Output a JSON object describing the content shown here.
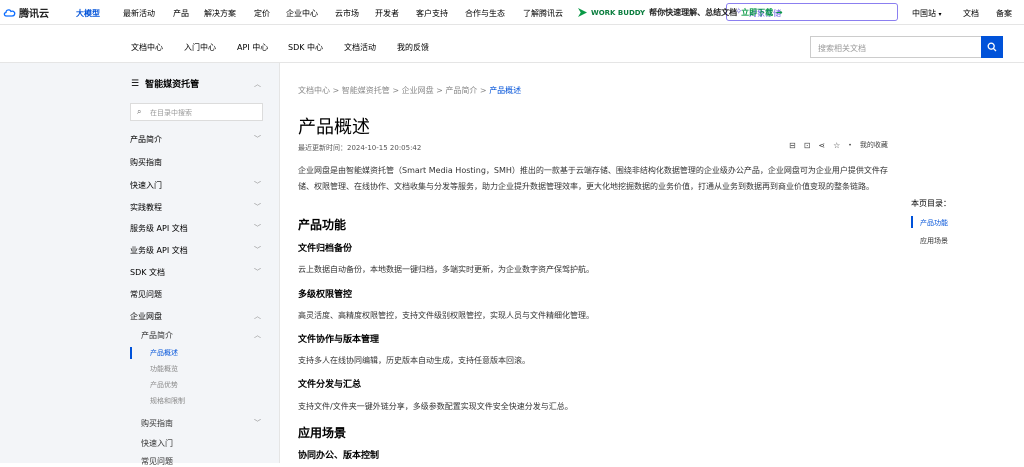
{
  "brand": {
    "name": "腾讯云"
  },
  "topnav": {
    "items": [
      "大模型",
      "最新活动",
      "产品",
      "解决方案",
      "定价",
      "企业中心",
      "云市场",
      "开发者",
      "客户支持",
      "合作与生态",
      "了解腾讯云"
    ],
    "search_placeholder": "对象存储",
    "region": "中国站",
    "docs": "文档",
    "beian": "备案"
  },
  "secnav": {
    "items": [
      "文档中心",
      "入门中心",
      "API 中心",
      "SDK 中心",
      "文档活动",
      "我的反馈"
    ],
    "workbuddy_logo": "WORK BUDDY",
    "workbuddy_text": "帮你快速理解、总结文档",
    "workbuddy_download": "立即下载 →",
    "search_placeholder": "搜索相关文档"
  },
  "sidebar": {
    "title": "智能媒资托管",
    "search_placeholder": "在目录中搜索",
    "items": [
      "产品简介",
      "购买指南",
      "快速入门",
      "实践教程",
      "服务级 API 文档",
      "业务级 API 文档",
      "SDK 文档",
      "常见问题",
      "企业网盘"
    ],
    "sub_items": [
      "产品简介",
      "购买指南",
      "快速入门",
      "常见问题"
    ],
    "sub2_items": [
      "产品概述",
      "功能概览",
      "产品优势",
      "规格和限制"
    ]
  },
  "breadcrumb": [
    "文档中心",
    "智能媒资托管",
    "企业网盘",
    "产品简介",
    "产品概述"
  ],
  "article": {
    "title": "产品概述",
    "updated": "最近更新时间：2024-10-15 20:05:42",
    "favorite": "我的收藏",
    "intro": "企业网盘是由智能媒资托管（Smart Media Hosting，SMH）推出的一款基于云端存储、围绕非结构化数据管理的企业级办公产品，企业网盘可为企业用户提供文件存储、权限管理、在线协作、文档收集与分发等服务，助力企业提升数据管理效率，更大化地挖掘数据的业务价值，打通从业务到数据再到商业价值变现的整条链路。",
    "h_features": "产品功能",
    "f1_title": "文件归档备份",
    "f1_text": "云上数据自动备份，本地数据一键归档，多端实时更新，为企业数字资产保驾护航。",
    "f2_title": "多级权限管控",
    "f2_text": "高灵活度、高精度权限管控，支持文件级别权限管控，实现人员与文件精细化管理。",
    "f3_title": "文件协作与版本管理",
    "f3_text": "支持多人在线协同编辑，历史版本自动生成，支持任意版本回滚。",
    "f4_title": "文件分发与汇总",
    "f4_text": "支持文件/文件夹一键外链分享，多级参数配置实现文件安全快速分发与汇总。",
    "h_scenarios": "应用场景",
    "s1_title": "协同办公、版本控制"
  },
  "toc": {
    "title": "本页目录：",
    "items": [
      "产品功能",
      "应用场景"
    ]
  },
  "colors": {
    "accent": "#0052d9",
    "sidebar_bg": "#f3f5f8"
  }
}
